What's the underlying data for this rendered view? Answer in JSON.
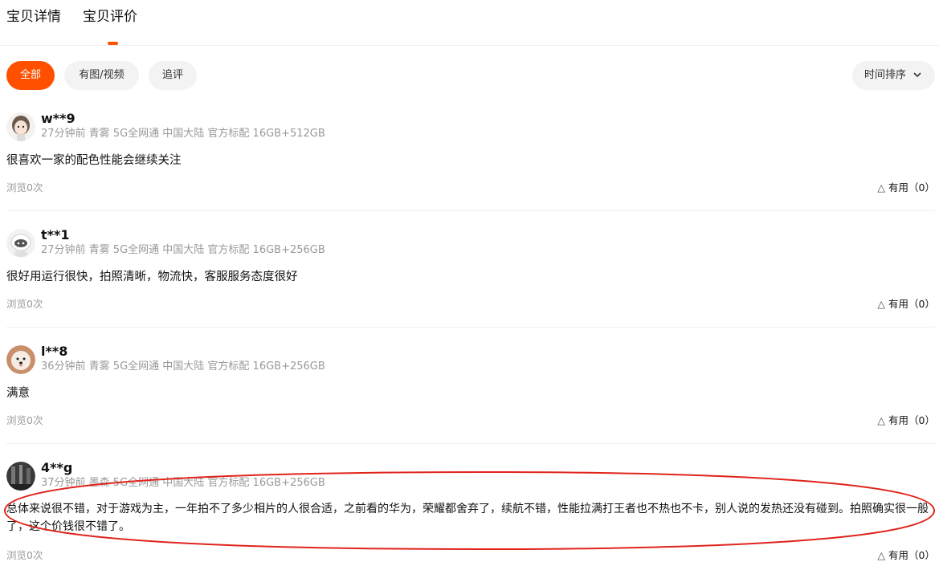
{
  "tabs": [
    {
      "label": "宝贝详情"
    },
    {
      "label": "宝贝评价",
      "active": true
    }
  ],
  "accent_color": "#ff5000",
  "filters": [
    {
      "label": "全部",
      "active": true
    },
    {
      "label": "有图/视频"
    },
    {
      "label": "追评"
    }
  ],
  "sort": {
    "label": "时间排序",
    "icon": "chevron-down-icon"
  },
  "reviews": [
    {
      "user": "w**9",
      "meta": "27分钟前 青雾 5G全网通 中国大陆 官方标配 16GB+512GB",
      "content": "很喜欢一家的配色性能会继续关注",
      "views": "浏览0次",
      "useful": "有用（0）",
      "avatar_icon": "avatar-cartoon-girl"
    },
    {
      "user": "t**1",
      "meta": "27分钟前 青雾 5G全网通 中国大陆 官方标配 16GB+256GB",
      "content": "很好用运行很快，拍照清晰，物流快，客服服务态度很好",
      "views": "浏览0次",
      "useful": "有用（0）",
      "avatar_icon": "avatar-default-robot"
    },
    {
      "user": "l**8",
      "meta": "36分钟前 青雾 5G全网通 中国大陆 官方标配 16GB+256GB",
      "content": "满意",
      "views": "浏览0次",
      "useful": "有用（0）",
      "avatar_icon": "avatar-dog"
    },
    {
      "user": "4**g",
      "meta": "37分钟前 墨森 5G全网通 中国大陆 官方标配 16GB+256GB",
      "content": "总体来说很不错，对于游戏为主，一年拍不了多少相片的人很合适，之前看的华为，荣耀都舍弃了，续航不错，性能拉满打王者也不热也不卡，别人说的发热还没有碰到。拍照确实很一般了，这个价钱很不错了。",
      "views": "浏览0次",
      "useful": "有用（0）",
      "avatar_icon": "avatar-dark-photo"
    }
  ],
  "useful_icon": "triangle-outline-icon",
  "annotation_color": "#e0241c"
}
